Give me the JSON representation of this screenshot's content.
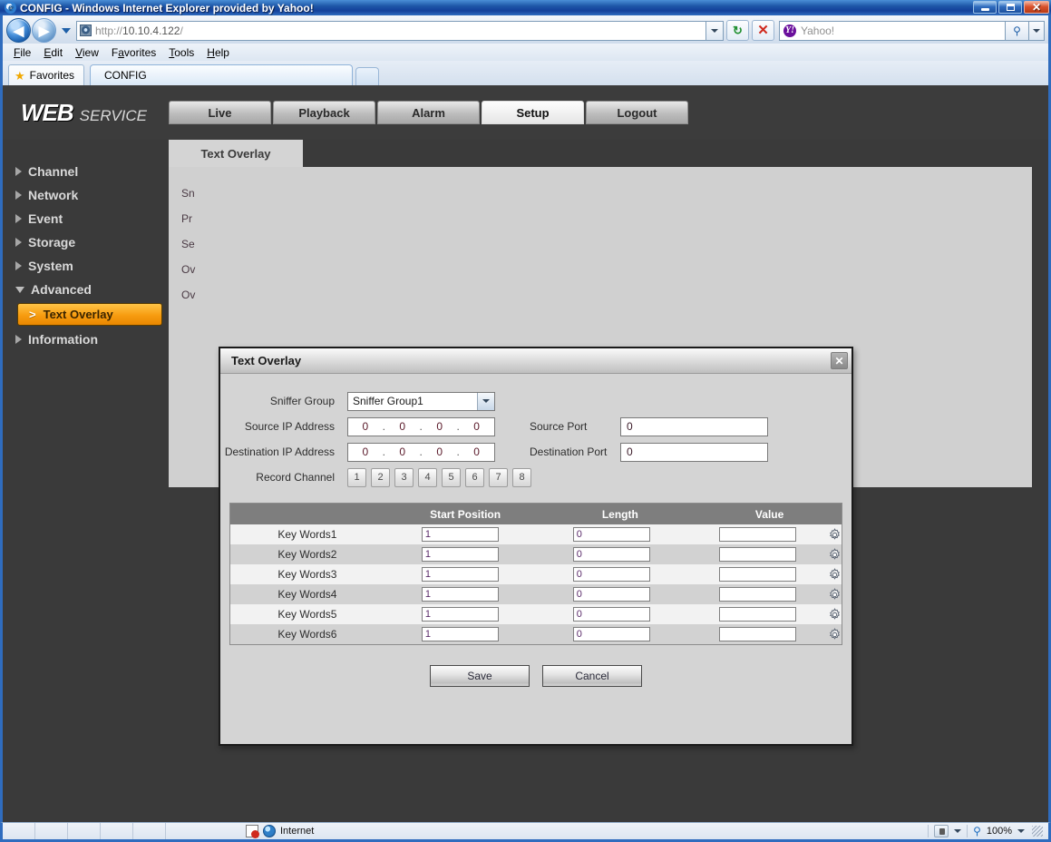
{
  "window": {
    "title": "CONFIG - Windows Internet Explorer provided by Yahoo!",
    "minimize_label": "Minimize",
    "maximize_label": "Maximize",
    "close_label": "Close"
  },
  "browser": {
    "back_label": "◀",
    "forward_label": "▶",
    "url_scheme": "http://",
    "url_host": "10.10.4.122",
    "url_path": "/",
    "url_full": "http://10.10.4.122/",
    "refresh_label": "↻",
    "stop_label": "✕",
    "search_placeholder": "Yahoo!",
    "search_value": "",
    "search_go_label": "🔍",
    "menu": [
      "File",
      "Edit",
      "View",
      "Favorites",
      "Tools",
      "Help"
    ],
    "favorites_label": "Favorites",
    "tab_label": "CONFIG"
  },
  "app": {
    "brand_primary": "WEB",
    "brand_secondary": "SERVICE",
    "nav_tabs": [
      {
        "label": "Live",
        "active": false
      },
      {
        "label": "Playback",
        "active": false
      },
      {
        "label": "Alarm",
        "active": false
      },
      {
        "label": "Setup",
        "active": true
      },
      {
        "label": "Logout",
        "active": false
      }
    ]
  },
  "sidebar": {
    "items": [
      {
        "label": "Channel",
        "expanded": false
      },
      {
        "label": "Network",
        "expanded": false
      },
      {
        "label": "Event",
        "expanded": false
      },
      {
        "label": "Storage",
        "expanded": false
      },
      {
        "label": "System",
        "expanded": false
      },
      {
        "label": "Advanced",
        "expanded": true
      }
    ],
    "sub_item": {
      "label": "Text Overlay",
      "chevron": ">"
    },
    "last_item": {
      "label": "Information",
      "expanded": false
    }
  },
  "content": {
    "tab_label": "Text Overlay",
    "obscured_labels": [
      "Sn",
      "Pr",
      "Se",
      "Ov",
      "Ov"
    ]
  },
  "dialog": {
    "title": "Text Overlay",
    "close_label": "✕",
    "fields": {
      "sniffer_group_label": "Sniffer Group",
      "sniffer_group_value": "Sniffer Group1",
      "source_ip_label": "Source IP Address",
      "source_ip_octets": [
        "0",
        "0",
        "0",
        "0"
      ],
      "destination_ip_label": "Destination IP Address",
      "destination_ip_octets": [
        "0",
        "0",
        "0",
        "0"
      ],
      "source_port_label": "Source Port",
      "source_port_value": "0",
      "destination_port_label": "Destination Port",
      "destination_port_value": "0",
      "record_channel_label": "Record Channel",
      "record_channels": [
        "1",
        "2",
        "3",
        "4",
        "5",
        "6",
        "7",
        "8"
      ]
    },
    "table": {
      "headers": [
        "",
        "Start Position",
        "Length",
        "Value",
        ""
      ],
      "rows": [
        {
          "name": "Key Words1",
          "start": "1",
          "length": "0",
          "value": ""
        },
        {
          "name": "Key Words2",
          "start": "1",
          "length": "0",
          "value": ""
        },
        {
          "name": "Key Words3",
          "start": "1",
          "length": "0",
          "value": ""
        },
        {
          "name": "Key Words4",
          "start": "1",
          "length": "0",
          "value": ""
        },
        {
          "name": "Key Words5",
          "start": "1",
          "length": "0",
          "value": ""
        },
        {
          "name": "Key Words6",
          "start": "1",
          "length": "0",
          "value": ""
        }
      ]
    },
    "buttons": {
      "save": "Save",
      "cancel": "Cancel"
    }
  },
  "statusbar": {
    "zone_label": "Internet",
    "zoom_label": "100%"
  },
  "colors": {
    "accent_orange": "#f79c10",
    "chrome_blue": "#2f6cbe",
    "panel_gray": "#d0d0d0",
    "dark_bg": "#3a3a3a",
    "table_header": "#7e7e7e"
  }
}
